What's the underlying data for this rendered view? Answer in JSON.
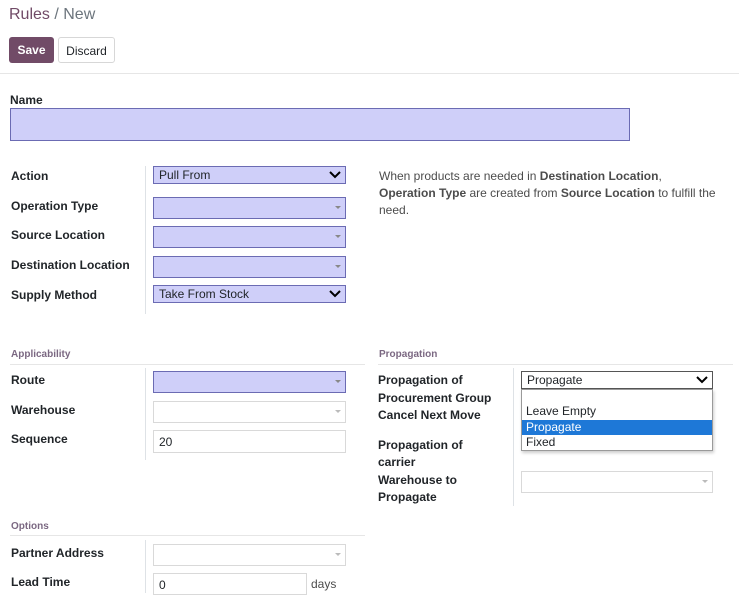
{
  "breadcrumb": {
    "root": "Rules",
    "separator": " / ",
    "current": "New"
  },
  "toolbar": {
    "save_label": "Save",
    "discard_label": "Discard"
  },
  "form": {
    "name_label": "Name",
    "name_value": "",
    "action_label": "Action",
    "action_value": "Pull From",
    "operation_type_label": "Operation Type",
    "source_location_label": "Source Location",
    "destination_location_label": "Destination Location",
    "supply_method_label": "Supply Method",
    "supply_method_value": "Take From Stock",
    "help": {
      "p1": "When products are needed in ",
      "b1": "Destination Location",
      "p2": ",",
      "b2": "Operation Type",
      "p3": " are created from ",
      "b3": "Source Location",
      "p4": " to fulfill the need."
    }
  },
  "applicability": {
    "title": "Applicability",
    "route_label": "Route",
    "warehouse_label": "Warehouse",
    "sequence_label": "Sequence",
    "sequence_value": "20"
  },
  "propagation": {
    "title": "Propagation",
    "group_label_1": "Propagation of",
    "group_label_2": "Procurement Group",
    "group_value": "Propagate",
    "cancel_label": "Cancel Next Move",
    "carrier_label_1": "Propagation of",
    "carrier_label_2": "carrier",
    "warehouse_label_1": "Warehouse to",
    "warehouse_label_2": "Propagate",
    "dropdown_options": [
      "",
      "Leave Empty",
      "Propagate",
      "Fixed"
    ],
    "dropdown_selected": "Propagate"
  },
  "options": {
    "title": "Options",
    "partner_label": "Partner Address",
    "lead_time_label": "Lead Time",
    "lead_time_value": "0",
    "lead_time_unit": "days"
  },
  "colors": {
    "accent": "#714b67",
    "required_field": "#cfcff9",
    "dropdown_highlight": "#1e78d7"
  }
}
